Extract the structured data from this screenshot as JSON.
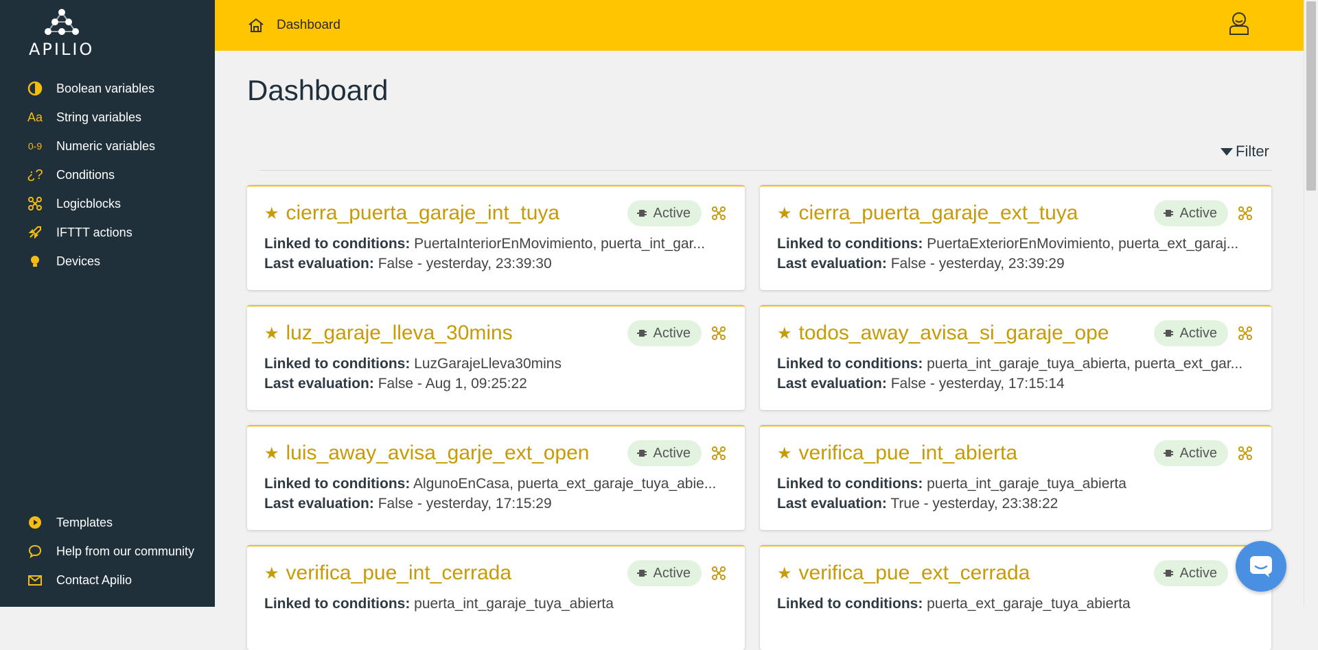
{
  "app": {
    "logo_text": "APILIO"
  },
  "colors": {
    "accent": "#ffc600",
    "sidebar": "#1f303b",
    "title_gold": "#c79a07",
    "badge_bg": "#e2f3e0"
  },
  "sidebar": {
    "items": [
      {
        "label": "Boolean variables",
        "icon": "half-circle-icon"
      },
      {
        "label": "String variables",
        "icon": "Aa"
      },
      {
        "label": "Numeric variables",
        "icon": "0-9"
      },
      {
        "label": "Conditions",
        "icon": "¿?"
      },
      {
        "label": "Logicblocks",
        "icon": "logicblock-icon"
      },
      {
        "label": "IFTTT actions",
        "icon": "rocket-icon"
      },
      {
        "label": "Devices",
        "icon": "bulb-icon"
      }
    ],
    "bottom_items": [
      {
        "label": "Templates",
        "icon": "play-circle-icon"
      },
      {
        "label": "Help from our community",
        "icon": "chat-bubble-icon"
      },
      {
        "label": "Contact Apilio",
        "icon": "mail-icon"
      }
    ]
  },
  "topbar": {
    "breadcrumb": "Dashboard"
  },
  "main": {
    "title": "Dashboard",
    "filter_label": "Filter",
    "linked_label": "Linked to conditions:",
    "last_eval_label": "Last evaluation:",
    "cards": [
      {
        "name": "cierra_puerta_garaje_int_tuya",
        "status": "Active",
        "linked": "PuertaInteriorEnMovimiento, puerta_int_gar...",
        "last_eval": "False - yesterday, 23:39:30"
      },
      {
        "name": "cierra_puerta_garaje_ext_tuya",
        "status": "Active",
        "linked": "PuertaExteriorEnMovimiento, puerta_ext_garaj...",
        "last_eval": "False - yesterday, 23:39:29"
      },
      {
        "name": "luz_garaje_lleva_30mins",
        "status": "Active",
        "linked": "LuzGarajeLleva30mins",
        "last_eval": "False - Aug 1, 09:25:22"
      },
      {
        "name": "todos_away_avisa_si_garaje_ope",
        "status": "Active",
        "linked": "puerta_int_garaje_tuya_abierta, puerta_ext_gar...",
        "last_eval": "False - yesterday, 17:15:14"
      },
      {
        "name": "luis_away_avisa_garje_ext_open",
        "status": "Active",
        "linked": "AlgunoEnCasa, puerta_ext_garaje_tuya_abie...",
        "last_eval": "False - yesterday, 17:15:29"
      },
      {
        "name": "verifica_pue_int_abierta",
        "status": "Active",
        "linked": "puerta_int_garaje_tuya_abierta",
        "last_eval": "True - yesterday, 23:38:22"
      },
      {
        "name": "verifica_pue_int_cerrada",
        "status": "Active",
        "linked": "puerta_int_garaje_tuya_abierta",
        "last_eval": ""
      },
      {
        "name": "verifica_pue_ext_cerrada",
        "status": "Active",
        "linked": "puerta_ext_garaje_tuya_abierta",
        "last_eval": ""
      }
    ]
  }
}
